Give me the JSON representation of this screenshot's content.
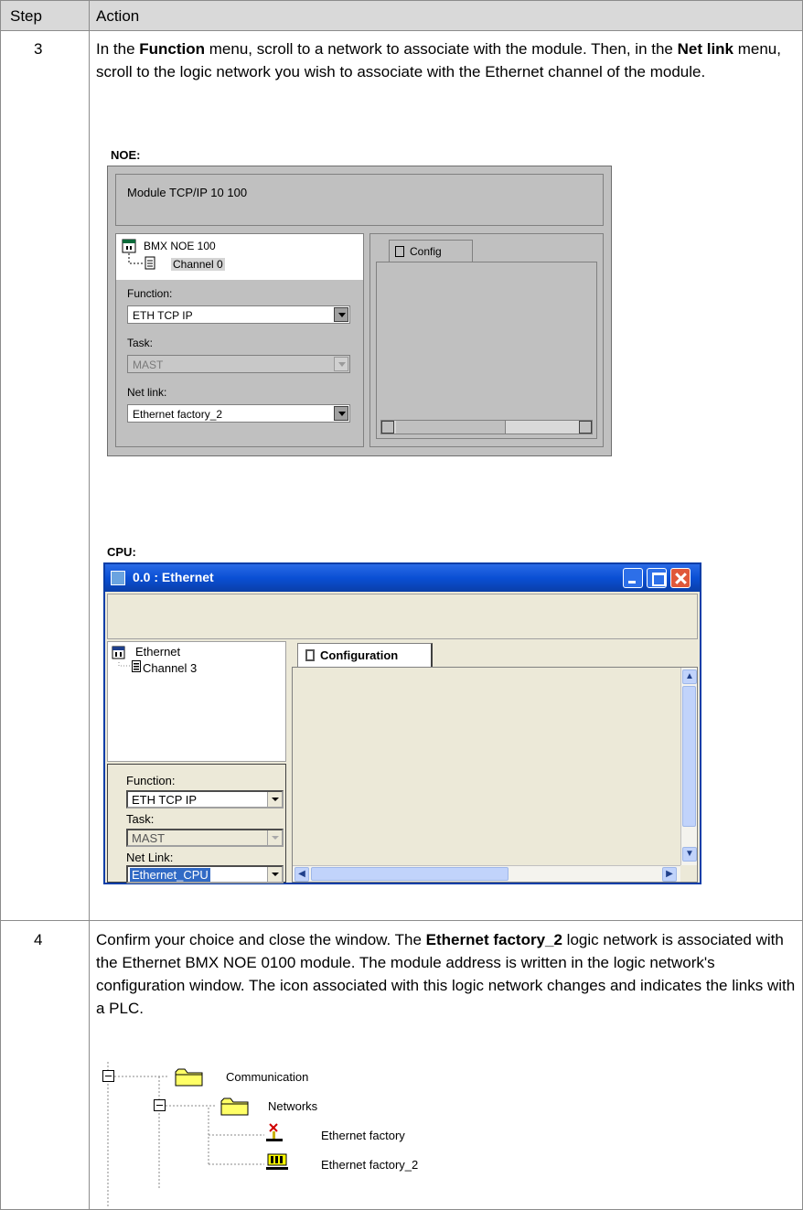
{
  "table": {
    "header": {
      "step": "Step",
      "action": "Action"
    },
    "rows": [
      {
        "step": "3",
        "text": {
          "p1": "In the ",
          "b1": "Function",
          "p2": " menu, scroll to a network to associate with the module. Then, in the ",
          "b2": "Net link",
          "p3": " menu, scroll to the logic network you wish to associate with the Ethernet channel of the module."
        }
      },
      {
        "step": "4",
        "text": {
          "p1": "Confirm your choice and close the window. The ",
          "b1": "Ethernet factory_2",
          "p2": " logic network is associated with the Ethernet BMX NOE 0100 module. The module address is written in the logic network's configuration window. The icon associated with this logic network changes and indicates the links with a PLC."
        }
      }
    ]
  },
  "noe": {
    "caption": "NOE:",
    "title": "Module TCP/IP 10 100",
    "tree": {
      "module": "BMX NOE 100",
      "channel": "Channel 0"
    },
    "function": {
      "label": "Function:",
      "value": "ETH TCP IP"
    },
    "task": {
      "label": "Task:",
      "value": "MAST"
    },
    "netlink": {
      "label": "Net link:",
      "value": "Ethernet factory_2"
    },
    "tab": "Config"
  },
  "cpu": {
    "caption": "CPU:",
    "window_title": "0.0 : Ethernet",
    "tree": {
      "root": "Ethernet",
      "channel": "Channel 3"
    },
    "function": {
      "label": "Function:",
      "value": "ETH TCP IP"
    },
    "task": {
      "label": "Task:",
      "value": "MAST"
    },
    "netlink": {
      "label": "Net Link:",
      "value": "Ethernet_CPU"
    },
    "tab": "Configuration"
  },
  "comm_tree": {
    "root": "Communication",
    "networks": "Networks",
    "items": [
      "Ethernet factory",
      "Ethernet factory_2"
    ]
  }
}
